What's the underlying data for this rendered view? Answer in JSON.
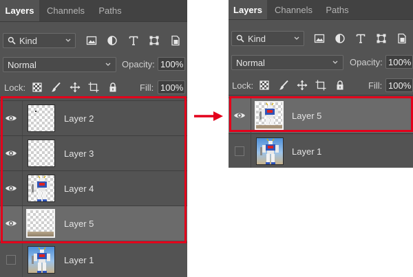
{
  "tabs": [
    "Layers",
    "Channels",
    "Paths"
  ],
  "filter": {
    "kind_label": "Kind"
  },
  "blend_mode": "Normal",
  "opacity": {
    "label": "Opacity:",
    "value": "100%"
  },
  "lock": {
    "label": "Lock:"
  },
  "fill": {
    "label": "Fill:",
    "value": "100%"
  },
  "icons": {
    "filter": [
      "image-filter-icon",
      "adjustment-filter-icon",
      "type-filter-icon",
      "shape-filter-icon",
      "smart-object-filter-icon"
    ],
    "lock": [
      "lock-transparent-pixels-icon",
      "lock-image-pixels-icon",
      "lock-position-icon",
      "lock-artboard-icon",
      "lock-all-icon"
    ]
  },
  "before": {
    "layers": [
      {
        "name": "Layer 2",
        "visible": true,
        "selected": false,
        "thumb": "transparent-dot"
      },
      {
        "name": "Layer 3",
        "visible": true,
        "selected": false,
        "thumb": "transparent"
      },
      {
        "name": "Layer 4",
        "visible": true,
        "selected": false,
        "thumb": "robot-cutout"
      },
      {
        "name": "Layer 5",
        "visible": true,
        "selected": true,
        "thumb": "ground-strip"
      },
      {
        "name": "Layer 1",
        "visible": false,
        "selected": false,
        "thumb": "robot-photo"
      }
    ]
  },
  "after": {
    "layers": [
      {
        "name": "Layer 5",
        "visible": true,
        "selected": true,
        "thumb": "robot-merged"
      },
      {
        "name": "Layer 1",
        "visible": false,
        "selected": false,
        "thumb": "robot-photo"
      }
    ]
  },
  "colors": {
    "highlight": "#e3001b",
    "panel": "#535353",
    "selected_row": "#6b6b6b"
  }
}
